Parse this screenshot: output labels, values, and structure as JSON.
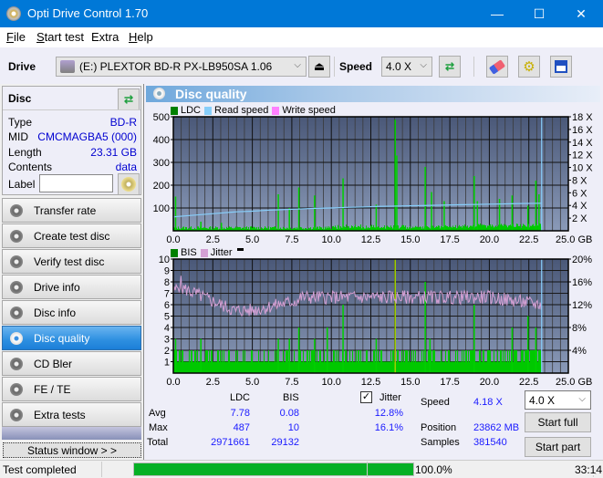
{
  "window": {
    "title": "Opti Drive Control 1.70",
    "minimize": "—",
    "maximize": "☐",
    "close": "✕"
  },
  "menu": [
    {
      "label": "File",
      "u": "F",
      "rest": "ile"
    },
    {
      "label": "Start test",
      "u": "S",
      "rest": "tart test"
    },
    {
      "label": "Extra",
      "u": "",
      "rest": "Extra"
    },
    {
      "label": "Help",
      "u": "H",
      "rest": "elp"
    }
  ],
  "toolbar": {
    "drive_label": "Drive",
    "drive_value": "(E:)  PLEXTOR BD-R  PX-LB950SA 1.06",
    "speed_label": "Speed",
    "speed_value": "4.0 X"
  },
  "disc": {
    "title": "Disc",
    "rows": [
      {
        "k": "Type",
        "v": "BD-R"
      },
      {
        "k": "MID",
        "v": "CMCMAGBA5 (000)"
      },
      {
        "k": "Length",
        "v": "23.31 GB"
      },
      {
        "k": "Contents",
        "v": "data"
      }
    ],
    "label_label": "Label",
    "label_value": ""
  },
  "nav": [
    {
      "label": "Transfer rate"
    },
    {
      "label": "Create test disc"
    },
    {
      "label": "Verify test disc"
    },
    {
      "label": "Drive info"
    },
    {
      "label": "Disc info"
    },
    {
      "label": "Disc quality",
      "active": true
    },
    {
      "label": "CD Bler"
    },
    {
      "label": "FE / TE"
    },
    {
      "label": "Extra tests"
    }
  ],
  "status_window_btn": "Status window > >",
  "panel_title": "Disc quality",
  "chart_data": [
    {
      "type": "bar",
      "title": "LDC",
      "legend": [
        "LDC",
        "Read speed",
        "Write speed"
      ],
      "legend_colors": [
        "#008000",
        "#87cefa",
        "#ff80ff"
      ],
      "x_ticks": [
        "0.0",
        "2.5",
        "5.0",
        "7.5",
        "10.0",
        "12.5",
        "15.0",
        "17.5",
        "20.0",
        "22.5",
        "25.0 GB"
      ],
      "xlim": [
        0,
        25
      ],
      "y_ticks": [
        "500",
        "400",
        "300",
        "200",
        "100"
      ],
      "ylim": [
        0,
        500
      ],
      "y2_ticks": [
        "18 X",
        "16 X",
        "14 X",
        "12 X",
        "10 X",
        "8 X",
        "6 X",
        "4 X",
        "2 X"
      ],
      "y2lim": [
        0,
        18
      ],
      "read_speed": [
        [
          0,
          2.2
        ],
        [
          1,
          2.4
        ],
        [
          2,
          2.6
        ],
        [
          3,
          2.8
        ],
        [
          4,
          3.0
        ],
        [
          5,
          3.1
        ],
        [
          6,
          3.25
        ],
        [
          7,
          3.35
        ],
        [
          8,
          3.45
        ],
        [
          9,
          3.55
        ],
        [
          10,
          3.6
        ],
        [
          11,
          3.7
        ],
        [
          12,
          3.75
        ],
        [
          13,
          3.85
        ],
        [
          14,
          3.9
        ],
        [
          15,
          3.95
        ],
        [
          16,
          4.0
        ],
        [
          17,
          4.05
        ],
        [
          18,
          4.1
        ],
        [
          19,
          4.15
        ],
        [
          20,
          4.2
        ],
        [
          21,
          4.25
        ],
        [
          22,
          4.3
        ],
        [
          23.3,
          4.35
        ]
      ],
      "ldc_spikes": [
        [
          0.1,
          150
        ],
        [
          1.7,
          40
        ],
        [
          3.0,
          35
        ],
        [
          6.6,
          160
        ],
        [
          7.3,
          100
        ],
        [
          7.9,
          190
        ],
        [
          8.9,
          155
        ],
        [
          10.7,
          230
        ],
        [
          12.8,
          115
        ],
        [
          14.0,
          487
        ],
        [
          14.1,
          330
        ],
        [
          15.9,
          280
        ],
        [
          16.3,
          170
        ],
        [
          17.1,
          130
        ],
        [
          19.0,
          240
        ],
        [
          19.2,
          130
        ],
        [
          20.6,
          140
        ],
        [
          21.4,
          155
        ],
        [
          22.4,
          110
        ],
        [
          22.9,
          220
        ],
        [
          23.1,
          160
        ]
      ],
      "end_gb": 23.31
    },
    {
      "type": "bar",
      "title": "BIS",
      "legend": [
        "BIS",
        "Jitter"
      ],
      "legend_colors": [
        "#008000",
        "#d4a0d4"
      ],
      "x_ticks": [
        "0.0",
        "2.5",
        "5.0",
        "7.5",
        "10.0",
        "12.5",
        "15.0",
        "17.5",
        "20.0",
        "22.5",
        "25.0 GB"
      ],
      "xlim": [
        0,
        25
      ],
      "y_ticks": [
        "10",
        "9",
        "8",
        "7",
        "6",
        "5",
        "4",
        "3",
        "2",
        "1"
      ],
      "ylim": [
        0,
        10
      ],
      "y2_ticks": [
        "20%",
        "16%",
        "12%",
        "8%",
        "4%"
      ],
      "y2lim": [
        0,
        20
      ],
      "jitter_avg": 12.8,
      "jitter_max": 16.1,
      "bis_spikes": [
        [
          0.1,
          3
        ],
        [
          1.7,
          3
        ],
        [
          6.6,
          3
        ],
        [
          7.3,
          3
        ],
        [
          7.9,
          4
        ],
        [
          8.9,
          3
        ],
        [
          9.7,
          4
        ],
        [
          10.7,
          6
        ],
        [
          12.8,
          3
        ],
        [
          14.0,
          10
        ],
        [
          15.9,
          8
        ],
        [
          16.2,
          3
        ],
        [
          19.0,
          6
        ],
        [
          21.4,
          4
        ],
        [
          22.4,
          5
        ],
        [
          22.9,
          4
        ]
      ],
      "end_gb": 23.31
    }
  ],
  "stats": {
    "col_ldc": "LDC",
    "col_bis": "BIS",
    "jitter_label": "Jitter",
    "jitter_checked": true,
    "rows": [
      {
        "k": "Avg",
        "ldc": "7.78",
        "bis": "0.08",
        "jit": "12.8%"
      },
      {
        "k": "Max",
        "ldc": "487",
        "bis": "10",
        "jit": "16.1%"
      },
      {
        "k": "Total",
        "ldc": "2971661",
        "bis": "29132",
        "jit": ""
      }
    ],
    "speed_label": "Speed",
    "speed_value": "4.18 X",
    "position_label": "Position",
    "position_value": "23862 MB",
    "samples_label": "Samples",
    "samples_value": "381540",
    "speed_select": "4.0 X",
    "start_full": "Start full",
    "start_part": "Start part"
  },
  "status": {
    "text": "Test completed",
    "progress": 100.0,
    "progress_text": "100.0%",
    "time": "33:14"
  }
}
